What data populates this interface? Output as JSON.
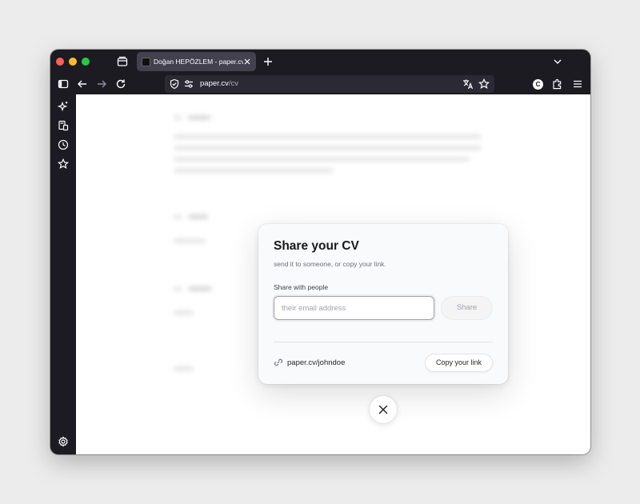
{
  "browser": {
    "tab": {
      "title": "Doğan HEPÖZLEM - paper.cv"
    },
    "url": {
      "host": "paper.cv",
      "path": "/cv"
    },
    "account_initial": "C"
  },
  "modal": {
    "title": "Share your CV",
    "subtitle": "send it to someone, or copy your link.",
    "share_label": "Share with people",
    "email_placeholder": "their email address",
    "share_button": "Share",
    "link_text": "paper.cv/johndoe",
    "copy_button": "Copy your link"
  },
  "colors": {
    "browser_chrome": "#1c1b22",
    "active_tab": "#42414d",
    "modal_background": "#f9fafb"
  }
}
